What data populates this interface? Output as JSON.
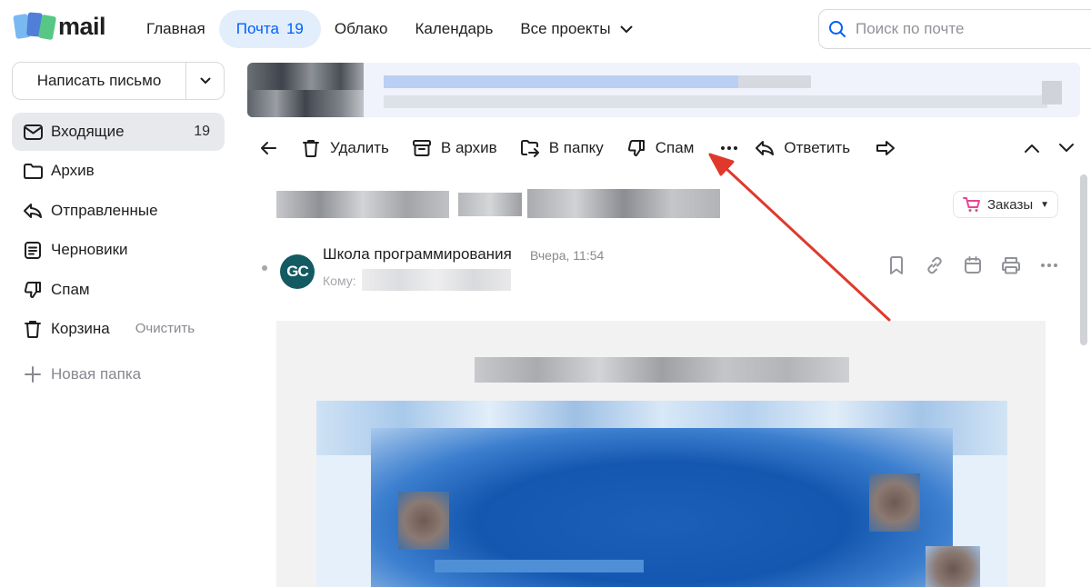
{
  "header": {
    "logo_text": "mail",
    "nav": [
      {
        "label": "Главная"
      },
      {
        "label": "Почта",
        "count": "19"
      },
      {
        "label": "Облако"
      },
      {
        "label": "Календарь"
      },
      {
        "label": "Все проекты"
      }
    ],
    "search_placeholder": "Поиск по почте"
  },
  "sidebar": {
    "compose_label": "Написать письмо",
    "folders": [
      {
        "label": "Входящие",
        "count": "19",
        "icon": "envelope-icon"
      },
      {
        "label": "Архив",
        "icon": "folder-icon"
      },
      {
        "label": "Отправленные",
        "icon": "send-icon"
      },
      {
        "label": "Черновики",
        "icon": "draft-icon"
      },
      {
        "label": "Спам",
        "icon": "thumbs-down-icon"
      },
      {
        "label": "Корзина",
        "action": "Очистить",
        "icon": "trash-icon"
      }
    ],
    "new_folder_label": "Новая папка"
  },
  "toolbar": {
    "delete_label": "Удалить",
    "archive_label": "В архив",
    "move_label": "В папку",
    "spam_label": "Спам",
    "reply_label": "Ответить"
  },
  "message": {
    "orders_label": "Заказы",
    "sender_name": "Школа программирования",
    "sender_initials": "GC",
    "time": "Вчера, 11:54",
    "to_label": "Кому:"
  },
  "colors": {
    "accent": "#005ff9",
    "active_nav_bg": "#e3eefc",
    "active_folder_bg": "#e8e9ec",
    "annotation_arrow": "#e0392b",
    "avatar_bg": "#135a62"
  }
}
